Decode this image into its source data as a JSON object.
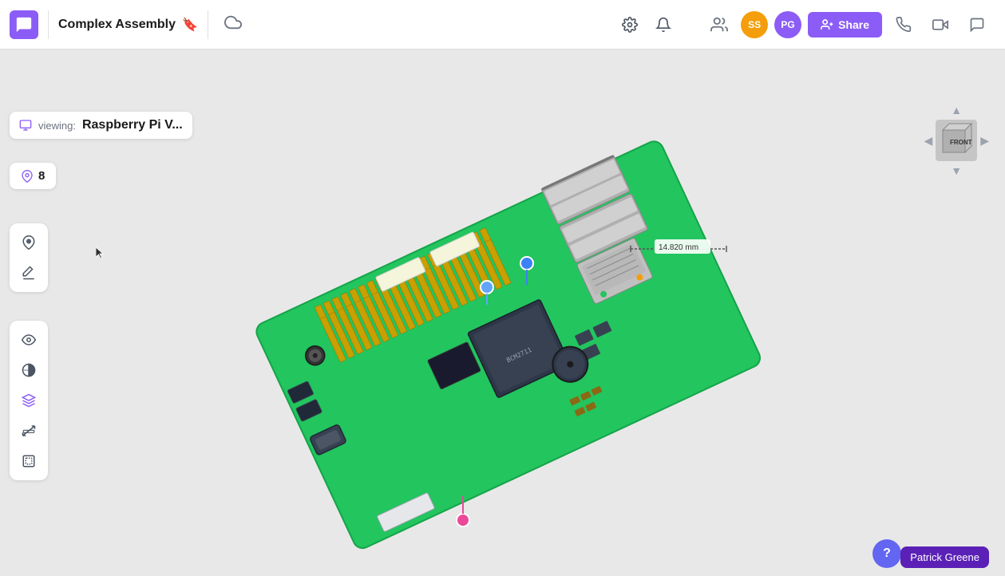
{
  "header": {
    "title": "Complex Assembly",
    "logo_label": "app-logo",
    "bookmark_label": "bookmark",
    "cloud_label": "cloud-sync",
    "settings_label": "settings",
    "notifications_label": "notifications",
    "share_label": "Share",
    "avatar_ss": "SS",
    "avatar_pg": "PG",
    "avatar_ss_color": "#f59e0b",
    "avatar_pg_color": "#8b5cf6",
    "call_label": "phone-call",
    "video_label": "video-call",
    "chat_label": "chat"
  },
  "viewing": {
    "prefix": "viewing:",
    "name": "Raspberry Pi V..."
  },
  "annotations": {
    "count": "8"
  },
  "toolbar1": {
    "add_annotation": "add-annotation",
    "edit_annotation": "edit-annotation"
  },
  "toolbar2": {
    "visibility": "visibility",
    "contrast": "contrast",
    "explode": "explode-view",
    "measure": "measure",
    "isolate": "isolate"
  },
  "viewport": {
    "measurement": "14.820 mm"
  },
  "cube": {
    "label": "FRONT"
  },
  "user_tooltip": {
    "name": "Patrick Greene"
  },
  "help": {
    "label": "?"
  }
}
